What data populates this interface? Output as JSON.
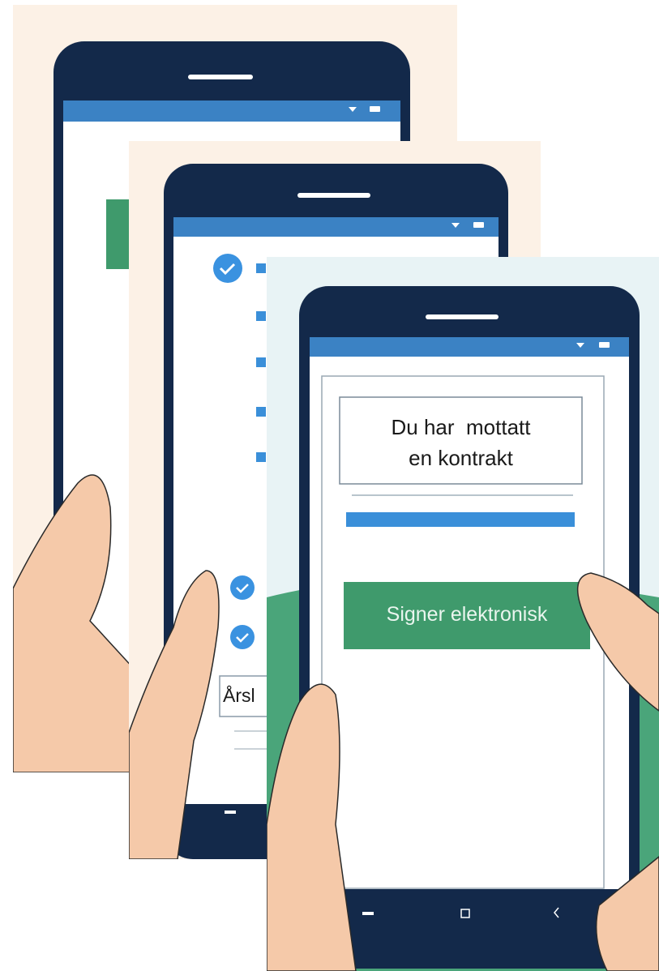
{
  "palette": {
    "card_bg_warm": "#fcf1e6",
    "card_bg_cool": "#e8f3f5",
    "phone_frame": "#13294a",
    "status_bar": "#3b82c4",
    "screen": "#ffffff",
    "accent_blue": "#3a8fd9",
    "check_circle": "#3a92e0",
    "green_button": "#3f9a6c",
    "skin": "#f5c9a9",
    "skin_outline": "#2a2a2a",
    "hill_green": "#4aa57a"
  },
  "icons": {
    "status_wifi": "wifi-icon",
    "status_battery": "battery-icon",
    "checkmark": "checkmark-circle-icon",
    "nav_recent": "recent-apps-icon",
    "nav_home": "home-square-icon",
    "nav_back": "back-chevron-icon"
  },
  "screens": {
    "middle": {
      "partial_label": "Årsl"
    },
    "front": {
      "message_line1": "Du har  mottatt",
      "message_line2": "en kontrakt",
      "sign_button_label": "Signer elektronisk"
    }
  }
}
